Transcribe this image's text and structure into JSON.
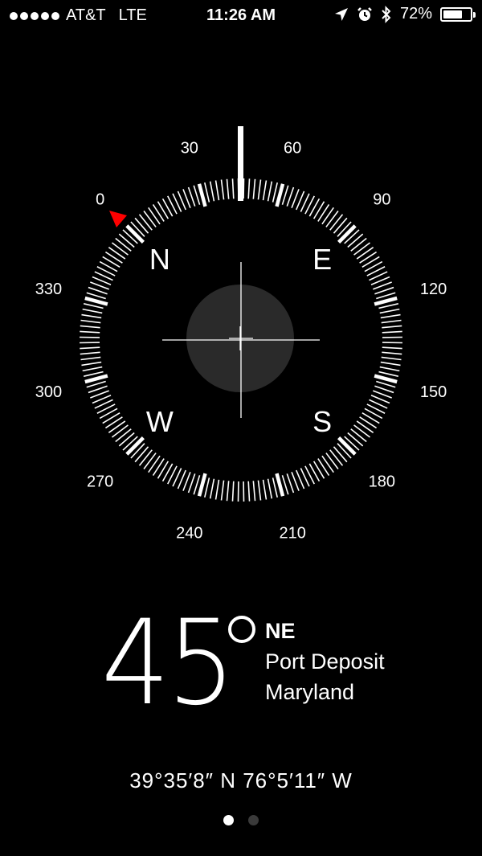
{
  "status_bar": {
    "signal_dots": 5,
    "carrier": "AT&T",
    "network": "LTE",
    "time": "11:26 AM",
    "battery_percent": "72%",
    "battery_level": 0.72,
    "icons": [
      "location-arrow-icon",
      "alarm-clock-icon",
      "bluetooth-icon",
      "battery-icon"
    ]
  },
  "compass": {
    "heading_degrees": 45,
    "degree_labels": [
      "0",
      "30",
      "60",
      "90",
      "120",
      "150",
      "180",
      "210",
      "240",
      "270",
      "300",
      "330"
    ],
    "cardinals": [
      "N",
      "E",
      "S",
      "W"
    ],
    "marker_color": "#ff0000",
    "tick_color": "#ffffff",
    "level_bubble_color": "#2a2a2a"
  },
  "heading": {
    "value": "45",
    "direction": "NE",
    "city": "Port Deposit",
    "region": "Maryland"
  },
  "coordinates": "39°35′8″ N  76°5′11″ W",
  "pagination": {
    "count": 2,
    "active": 0
  }
}
